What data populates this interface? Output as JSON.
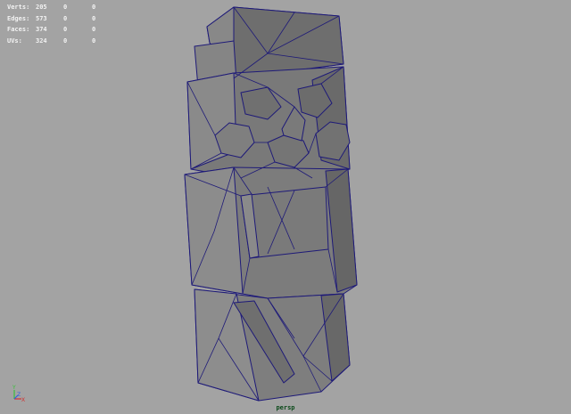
{
  "viewport": {
    "camera_label": "persp",
    "background": "#a3a3a3",
    "wire_color": "#1e1a78",
    "face_color": "#7b7b7b"
  },
  "heads_up": {
    "rows": [
      {
        "label": "Verts:",
        "value": "205",
        "sel": "0",
        "comp": "0"
      },
      {
        "label": "Edges:",
        "value": "573",
        "sel": "0",
        "comp": "0"
      },
      {
        "label": "Faces:",
        "value": "374",
        "sel": "0",
        "comp": "0"
      },
      {
        "label": "UVs:",
        "value": "324",
        "sel": "0",
        "comp": "0"
      }
    ]
  },
  "axis_gizmo": {
    "y": "Y",
    "z": "Z",
    "x": "X"
  },
  "icons": {
    "axis": "xyz-axis-icon"
  }
}
